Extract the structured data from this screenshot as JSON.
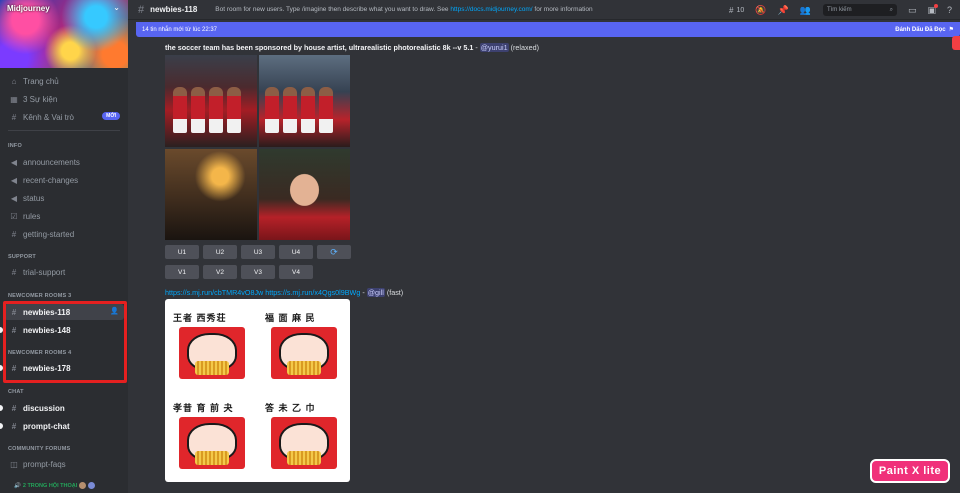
{
  "server": {
    "name": "Midjourney"
  },
  "nav": {
    "home": "Trang chủ",
    "events": "3 Sự kiện",
    "channels_roles": "Kênh & Vai trò",
    "new_badge": "MỚI"
  },
  "categories": {
    "info": "INFO",
    "support": "SUPPORT",
    "newcomer3": "NEWCOMER ROOMS 3",
    "newcomer4": "NEWCOMER ROOMS 4",
    "chat": "CHAT",
    "forums": "COMMUNITY FORUMS"
  },
  "channels": {
    "announcements": "announcements",
    "recent_changes": "recent-changes",
    "status": "status",
    "rules": "rules",
    "getting_started": "getting-started",
    "trial_support": "trial-support",
    "newbies_118": "newbies-118",
    "newbies_148": "newbies-148",
    "newbies_178": "newbies-178",
    "discussion": "discussion",
    "prompt_chat": "prompt-chat",
    "prompt_faqs": "prompt-faqs"
  },
  "voice": {
    "label": "2 TRONG HỘI THOẠI"
  },
  "topbar": {
    "channel": "newbies-118",
    "topic_before": "Bot room for new users. Type /imagine then describe what you want to draw. See ",
    "topic_link": "https://docs.midjourney.com/",
    "topic_after": " for more information",
    "threads_count": "10",
    "search_placeholder": "Tìm kiếm"
  },
  "newbar": {
    "text": "14 tin nhắn mới từ lúc 22:37",
    "mark_read": "Đánh Dấu Đã Đọc"
  },
  "message1": {
    "prompt": "the soccer team has been sponsored by house artist, ultrarealistic photorealistic 8k --v 5.1",
    "separator": " - ",
    "mention": "@yurui1",
    "mode": "(relaxed)"
  },
  "buttons": {
    "upscale": [
      "U1",
      "U2",
      "U3",
      "U4"
    ],
    "variation": [
      "V1",
      "V2",
      "V3",
      "V4"
    ],
    "reroll_icon": "refresh-icon"
  },
  "message2": {
    "link1": "https://s.mj.run/cbTMR4vO8Jw",
    "link2": "https://s.mj.run/x4Qgs0l9BWg",
    "separator": " - ",
    "mention": "@gill",
    "mode": "(fast)"
  },
  "poster_titles": [
    "王者 西秀荘",
    "福 面 麻 民",
    "孝昔 育 前 夬",
    "答 未 乙 巾"
  ],
  "watermark": "Paint X lite",
  "colors": {
    "accent": "#5865f2",
    "link": "#00a8fc",
    "highlight_box": "#e52020",
    "watermark": "#f0317a"
  }
}
